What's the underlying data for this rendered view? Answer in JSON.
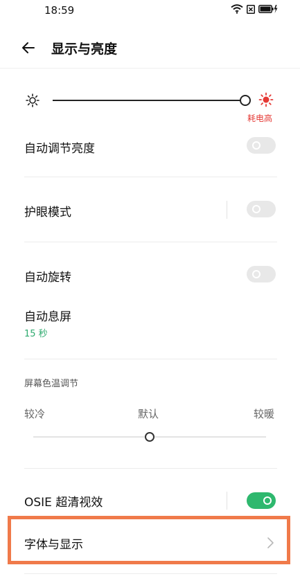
{
  "status_bar": {
    "time": "18:59"
  },
  "header": {
    "title": "显示与亮度"
  },
  "brightness": {
    "power_hint": "耗电高",
    "level": 1.0
  },
  "rows": {
    "auto_brightness": {
      "label": "自动调节亮度",
      "enabled": false
    },
    "eye_care": {
      "label": "护眼模式",
      "enabled": false
    },
    "auto_rotate": {
      "label": "自动旋转",
      "enabled": false
    },
    "screen_timeout": {
      "label": "自动息屏",
      "value": "15 秒"
    },
    "color_temp": {
      "title": "屏幕色温调节",
      "cooler": "较冷",
      "default": "默认",
      "warmer": "较暖",
      "level": 0.5
    },
    "osie": {
      "label": "OSIE 超清视效",
      "enabled": true
    },
    "font_display": {
      "label": "字体与显示"
    }
  },
  "colors": {
    "accent_green": "#2eb86e",
    "warning_red": "#e53935",
    "highlight_orange": "#f07a4a"
  }
}
